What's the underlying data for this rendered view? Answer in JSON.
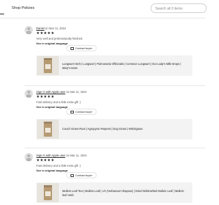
{
  "tabs": {
    "reviews_label": "t",
    "policies_label": "Shop Policies"
  },
  "search": {
    "placeholder": "Search all 0 items"
  },
  "reviews": [
    {
      "reviewer": "Daniel",
      "date_prefix": "on",
      "date": "Mar 11, 2024",
      "stars": "★★★★★",
      "text": "Very well and professionally finished",
      "translate_label": "See in original language",
      "contact_label": "Contact buyer",
      "product_title_lines": [
        "Lungwort Herb | Lungwort | Pulmonaria Officinalis | Common Lungwort | Our Lady's Milk Drops |",
        "Mary's tears"
      ]
    },
    {
      "reviewer": "Sign in with Apple user",
      "date_prefix": "on",
      "date": "Mar 11, 2024",
      "stars": "★★★★★",
      "text": "Fast delivery and a little extra gift :)",
      "translate_label": "See in original language",
      "contact_label": "Contact buyer",
      "product_title_lines": [
        "Couch Grass Root | Agropyron Repens | Dog Grass | Witchgrass"
      ]
    },
    {
      "reviewer": "Sign in with Apple user",
      "date_prefix": "on",
      "date": "Mar 11, 2024",
      "stars": "★★★★★",
      "text": "Fast delivery and a little extra gift :)",
      "translate_label": "See in original language",
      "contact_label": "Contact buyer",
      "product_title_lines": [
        "Mullein Leaf Tea | Mullein Leaf | c/s (Verbascum thapsus) | Dried Wildcrafted Mullein Leaf | Mullein",
        "leaf Herb"
      ]
    }
  ]
}
